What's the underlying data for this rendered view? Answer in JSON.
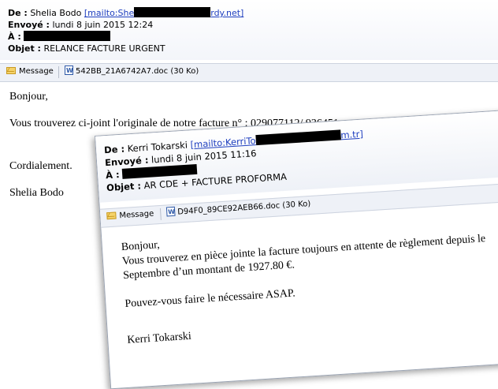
{
  "email1": {
    "from_label": "De :",
    "from_name": "Shelia Bodo",
    "from_link_prefix": "[mailto:She",
    "from_link_suffix": "rdy.net]",
    "sent_label": "Envoyé :",
    "sent_value": "lundi 8 juin 2015 12:24",
    "to_label": "À :",
    "subject_label": "Objet :",
    "subject_value": "RELANCE FACTURE URGENT",
    "message_button": "Message",
    "attachment": "542BB_21A6742A7.doc (30 Ko)",
    "body": {
      "greeting": "Bonjour,",
      "line1": "Vous trouverez ci-joint l'originale de notre facture n° : 029077112/ 936451",
      "closing": "Cordialement.",
      "signature": "Shelia Bodo"
    }
  },
  "email2": {
    "from_label": "De :",
    "from_name": "Kerri Tokarski",
    "from_link_prefix": "[mailto:KerriTo",
    "from_link_suffix": "m.tr]",
    "sent_label": "Envoyé :",
    "sent_value": "lundi 8 juin 2015 11:16",
    "to_label": "À :",
    "subject_label": "Objet :",
    "subject_value": "AR CDE + FACTURE PROFORMA",
    "message_button": "Message",
    "attachment": "D94F0_89CE92AEB66.doc (30 Ko)",
    "body": {
      "greeting": "Bonjour,",
      "line1": "Vous trouverez en pièce jointe la facture toujours en attente de règlement depuis le",
      "line2": "Septembre d’un montant de 1927.80 €.",
      "line3": "Pouvez-vous faire le nécessaire ASAP.",
      "signature": "Kerri Tokarski"
    }
  },
  "icons": {
    "message": "envelope-icon",
    "attachment": "word-document-icon"
  }
}
